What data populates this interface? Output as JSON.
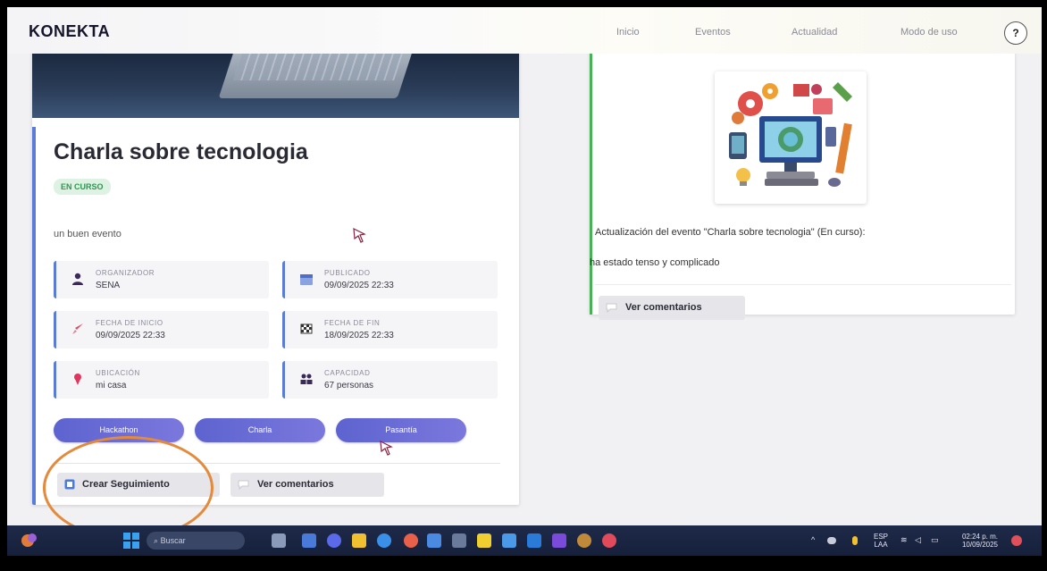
{
  "header": {
    "brand": "KONEKTA",
    "nav": [
      "Inicio",
      "Eventos",
      "Actualidad",
      "Modo de uso"
    ],
    "help_label": "?"
  },
  "event": {
    "title": "Charla sobre tecnologia",
    "status": "EN CURSO",
    "description": "un buen evento",
    "info": [
      {
        "label": "ORGANIZADOR",
        "value": "SENA",
        "icon": "person-icon"
      },
      {
        "label": "PUBLICADO",
        "value": "09/09/2025 22:33",
        "icon": "calendar-icon"
      },
      {
        "label": "FECHA DE INICIO",
        "value": "09/09/2025 22:33",
        "icon": "rocket-icon"
      },
      {
        "label": "FECHA DE FIN",
        "value": "18/09/2025 22:33",
        "icon": "flag-icon"
      },
      {
        "label": "UBICACIÓN",
        "value": "mi casa",
        "icon": "location-pin-icon"
      },
      {
        "label": "CAPACIDAD",
        "value": "67 personas",
        "icon": "people-icon"
      }
    ],
    "tags": [
      "Hackathon",
      "Charla",
      "Pasantía"
    ],
    "actions": {
      "follow_up": "Crear Seguimiento",
      "comments": "Ver comentarios"
    }
  },
  "update": {
    "title": "Actualización del evento \"Charla sobre tecnologia\" (En curso):",
    "text": "ha estado tenso y complicado",
    "comments": "Ver comentarios"
  },
  "taskbar": {
    "search_placeholder": "Buscar",
    "lang_top": "ESP",
    "lang_bottom": "LAA",
    "time": "02:24 p. m.",
    "date": "10/09/2025"
  },
  "colors": {
    "accent_blue": "#5a7bd8",
    "tag_purple": "#6a6bd6",
    "status_green": "#2e9650",
    "update_border": "#46b255",
    "highlight_orange": "#e48a3c"
  }
}
